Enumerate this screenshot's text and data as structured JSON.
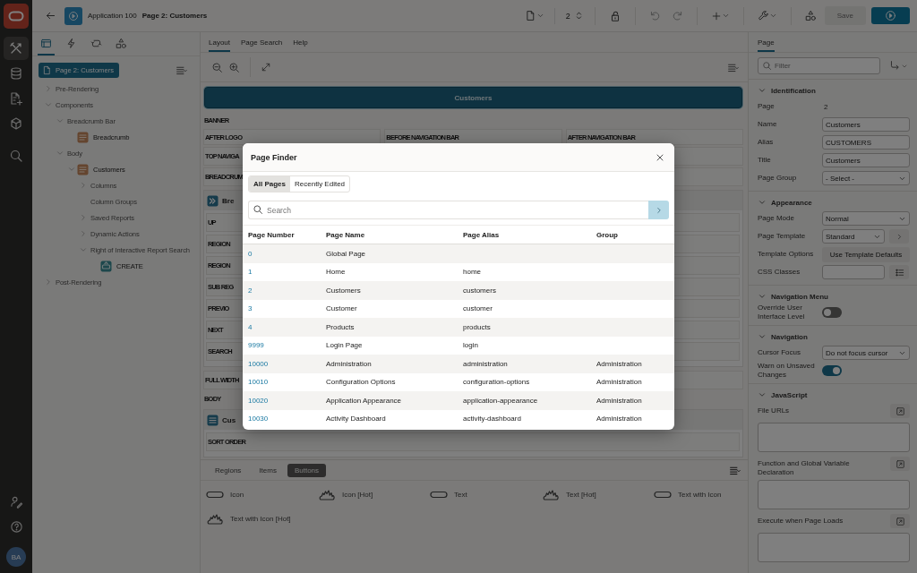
{
  "nav": {
    "items": [
      {
        "selected": true
      },
      {
        "selected": false
      },
      {
        "selected": false
      },
      {
        "selected": false
      },
      {
        "selected": false
      }
    ],
    "avatar": "BA"
  },
  "topbar": {
    "app": "Application 100",
    "page": "Page 2: Customers",
    "page_number": "2",
    "save": "Save",
    "save_disabled": true
  },
  "tree": {
    "tabs": [
      {
        "selected": true
      },
      {
        "selected": false
      },
      {
        "selected": false
      },
      {
        "selected": false
      }
    ],
    "root": {
      "label": "Page 2: Customers",
      "selected": true
    },
    "items": [
      {
        "label": "Pre-Rendering",
        "kind": "group",
        "expanded": false,
        "selected": false
      },
      {
        "label": "Components",
        "kind": "group",
        "expanded": true,
        "selected": false,
        "children": [
          {
            "label": "Breadcrumb Bar",
            "kind": "group",
            "expanded": true,
            "selected": false,
            "children": [
              {
                "label": "Breadcrumb",
                "kind": "region",
                "expanded": false,
                "selected": false
              }
            ]
          },
          {
            "label": "Body",
            "kind": "group",
            "expanded": true,
            "selected": false,
            "children": [
              {
                "label": "Customers",
                "kind": "region",
                "expanded": true,
                "selected": false,
                "children": [
                  {
                    "label": "Columns",
                    "kind": "group",
                    "expanded": false,
                    "selected": false
                  },
                  {
                    "label": "Column Groups",
                    "kind": "leaf",
                    "expanded": false,
                    "selected": false
                  },
                  {
                    "label": "Saved Reports",
                    "kind": "group",
                    "expanded": false,
                    "selected": false
                  },
                  {
                    "label": "Dynamic Actions",
                    "kind": "group",
                    "expanded": false,
                    "selected": false
                  },
                  {
                    "label": "Right of Interactive Report Search",
                    "kind": "group",
                    "expanded": true,
                    "selected": false,
                    "children": [
                      {
                        "label": "CREATE",
                        "kind": "button",
                        "expanded": false,
                        "selected": false
                      }
                    ]
                  }
                ]
              }
            ]
          }
        ]
      },
      {
        "label": "Post-Rendering",
        "kind": "group",
        "expanded": false,
        "selected": false
      }
    ]
  },
  "layout": {
    "tabs": [
      {
        "label": "Layout",
        "selected": true
      },
      {
        "label": "Page Search",
        "selected": false
      },
      {
        "label": "Help",
        "selected": false
      }
    ],
    "title": "Customers",
    "rows": [
      {
        "kind": "label",
        "text": "BANNER"
      },
      {
        "kind": "columns",
        "cells": [
          "AFTER LOGO",
          "BEFORE NAVIGATION BAR",
          "AFTER NAVIGATION BAR"
        ]
      },
      {
        "kind": "label",
        "text": "TOP NAVIGA"
      },
      {
        "kind": "label",
        "text": "BREADCRUM"
      },
      {
        "kind": "card",
        "title": "Bre",
        "slots": [
          "UP",
          "REGION",
          "REGION",
          "SUB REG",
          "PREVIO",
          "NEXT",
          "SEARCH"
        ]
      },
      {
        "kind": "label",
        "text": "FULL WIDTH"
      },
      {
        "kind": "label",
        "text": "BODY"
      },
      {
        "kind": "card",
        "title": "Cus",
        "slots": [
          "SORT ORDER"
        ]
      }
    ]
  },
  "gallery": {
    "tabs": [
      {
        "label": "Regions",
        "selected": false
      },
      {
        "label": "Items",
        "selected": false
      },
      {
        "label": "Buttons",
        "selected": true
      }
    ],
    "items": [
      {
        "label": "Icon",
        "kind": "normal"
      },
      {
        "label": "Icon [Hot]",
        "kind": "hot"
      },
      {
        "label": "Text",
        "kind": "normal"
      },
      {
        "label": "Text [Hot]",
        "kind": "hot"
      },
      {
        "label": "Text with Icon",
        "kind": "normal"
      },
      {
        "label": "Text with Icon [Hot]",
        "kind": "hot"
      }
    ]
  },
  "properties": {
    "tab": "Page",
    "filter_placeholder": "Filter",
    "sections": [
      {
        "title": "Identification",
        "expanded": true,
        "props": [
          {
            "kind": "static",
            "label": "Page",
            "value": "2"
          },
          {
            "kind": "text",
            "label": "Name",
            "value": "Customers"
          },
          {
            "kind": "text",
            "label": "Alias",
            "value": "CUSTOMERS"
          },
          {
            "kind": "text",
            "label": "Title",
            "value": "Customers"
          },
          {
            "kind": "select",
            "label": "Page Group",
            "value": "- Select -"
          }
        ]
      },
      {
        "title": "Appearance",
        "expanded": true,
        "props": [
          {
            "kind": "select",
            "label": "Page Mode",
            "value": "Normal"
          },
          {
            "kind": "select_button",
            "label": "Page Template",
            "value": "Standard"
          },
          {
            "kind": "button",
            "label": "Template Options",
            "value": "Use Template Defaults"
          },
          {
            "kind": "text_button",
            "label": "CSS Classes"
          }
        ]
      },
      {
        "title": "Navigation Menu",
        "expanded": true,
        "props": [
          {
            "kind": "switch",
            "label": "Override User Interface Level",
            "on": false
          }
        ]
      },
      {
        "title": "Navigation",
        "expanded": true,
        "props": [
          {
            "kind": "select",
            "label": "Cursor Focus",
            "value": "Do not focus cursor"
          },
          {
            "kind": "switch",
            "label": "Warn on Unsaved Changes",
            "on": true
          }
        ]
      },
      {
        "title": "JavaScript",
        "expanded": true,
        "props": [
          {
            "kind": "code",
            "label": "File URLs"
          },
          {
            "kind": "code",
            "label": "Function and Global Variable Declaration"
          },
          {
            "kind": "code",
            "label": "Execute when Page Loads"
          }
        ]
      }
    ]
  },
  "finder": {
    "title": "Page Finder",
    "tabs": [
      {
        "label": "All Pages",
        "selected": true
      },
      {
        "label": "Recently Edited",
        "selected": false
      }
    ],
    "search_placeholder": "Search",
    "columns": [
      "Page Number",
      "Page Name",
      "Page Alias",
      "Group"
    ],
    "rows": [
      {
        "number": "0",
        "name": "Global Page"
      },
      {
        "number": "1",
        "name": "Home",
        "alias": "home"
      },
      {
        "number": "2",
        "name": "Customers",
        "alias": "customers"
      },
      {
        "number": "3",
        "name": "Customer",
        "alias": "customer"
      },
      {
        "number": "4",
        "name": "Products",
        "alias": "products"
      },
      {
        "number": "9999",
        "name": "Login Page",
        "alias": "login"
      },
      {
        "number": "10000",
        "name": "Administration",
        "alias": "administration",
        "group": "Administration"
      },
      {
        "number": "10010",
        "name": "Configuration Options",
        "alias": "configuration-options",
        "group": "Administration"
      },
      {
        "number": "10020",
        "name": "Application Appearance",
        "alias": "application-appearance",
        "group": "Administration"
      },
      {
        "number": "10030",
        "name": "Activity Dashboard",
        "alias": "activity-dashboard",
        "group": "Administration"
      }
    ]
  }
}
